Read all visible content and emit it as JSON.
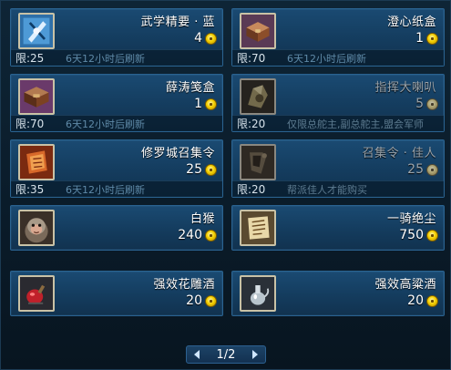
{
  "items": [
    {
      "name": "武学精要 · 蓝",
      "price": "4",
      "limit": "限:25",
      "refresh": "6天12小时后刷新",
      "icon": "blue-martial-scroll-icon",
      "dim": false
    },
    {
      "name": "澄心纸盒",
      "price": "1",
      "limit": "限:70",
      "refresh": "6天12小时后刷新",
      "icon": "paper-box-icon",
      "dim": false
    },
    {
      "name": "薛涛笺盒",
      "price": "1",
      "limit": "限:70",
      "refresh": "6天12小时后刷新",
      "icon": "letter-paper-box-icon",
      "dim": false
    },
    {
      "name": "指挥大喇叭",
      "price": "5",
      "limit": "限:20",
      "refresh": "仅限总舵主,副总舵主,盟会军师",
      "icon": "golden-horn-icon",
      "dim": true
    },
    {
      "name": "修罗城召集令",
      "price": "25",
      "limit": "限:35",
      "refresh": "6天12小时后刷新",
      "icon": "summon-token-icon",
      "dim": false
    },
    {
      "name": "召集令 · 佳人",
      "price": "25",
      "limit": "限:20",
      "refresh": "帮派佳人才能购买",
      "icon": "summon-beauty-icon",
      "dim": true
    },
    {
      "name": "白猴",
      "price": "240",
      "icon": "white-monkey-icon"
    },
    {
      "name": "一骑绝尘",
      "price": "750",
      "icon": "scroll-parchment-icon"
    },
    {
      "name": "强效花雕酒",
      "price": "20",
      "icon": "red-wine-gourd-icon"
    },
    {
      "name": "强效高粱酒",
      "price": "20",
      "icon": "silver-wine-pot-icon"
    }
  ],
  "pager": {
    "label": "1/2"
  },
  "colors": {
    "card_bg": "#1a4a72",
    "card_border": "#2a6391",
    "coin": "#f4d000",
    "refresh_text": "#5f8aa8"
  }
}
